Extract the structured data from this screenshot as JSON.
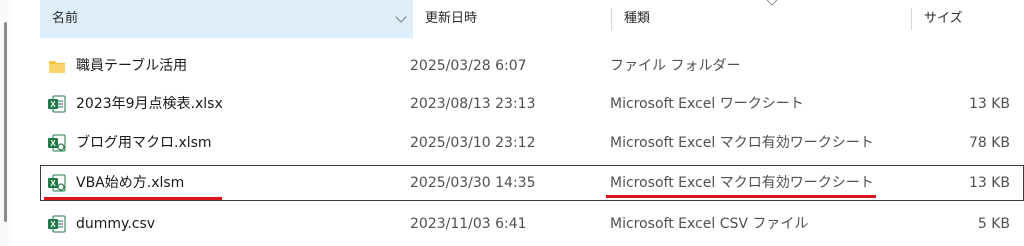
{
  "header": {
    "name": "名前",
    "date": "更新日時",
    "type": "種類",
    "size": "サイズ"
  },
  "rows": [
    {
      "icon": "folder-icon",
      "name": "職員テーブル活用",
      "date": "2025/03/28 6:07",
      "type": "ファイル フォルダー",
      "size": ""
    },
    {
      "icon": "excel-file-icon",
      "name": "2023年9月点検表.xlsx",
      "date": "2023/08/13 23:13",
      "type": "Microsoft Excel ワークシート",
      "size": "13 KB"
    },
    {
      "icon": "excel-macro-file-icon",
      "name": "ブログ用マクロ.xlsm",
      "date": "2025/03/10 23:12",
      "type": "Microsoft Excel マクロ有効ワークシート",
      "size": "78 KB"
    },
    {
      "icon": "excel-macro-file-icon",
      "name": "VBA始め方.xlsm",
      "date": "2025/03/30 14:35",
      "type": "Microsoft Excel マクロ有効ワークシート",
      "size": "13 KB"
    },
    {
      "icon": "excel-file-icon",
      "name": "dummy.csv",
      "date": "2023/11/03 6:41",
      "type": "Microsoft Excel CSV ファイル",
      "size": "5 KB"
    }
  ],
  "colors": {
    "selection_border": "#3a3a3a",
    "header_highlight": "#dfeefb",
    "annotation_underline": "#e0151b",
    "excel_green": "#1d7a45",
    "folder_yellow": "#f6c443"
  }
}
